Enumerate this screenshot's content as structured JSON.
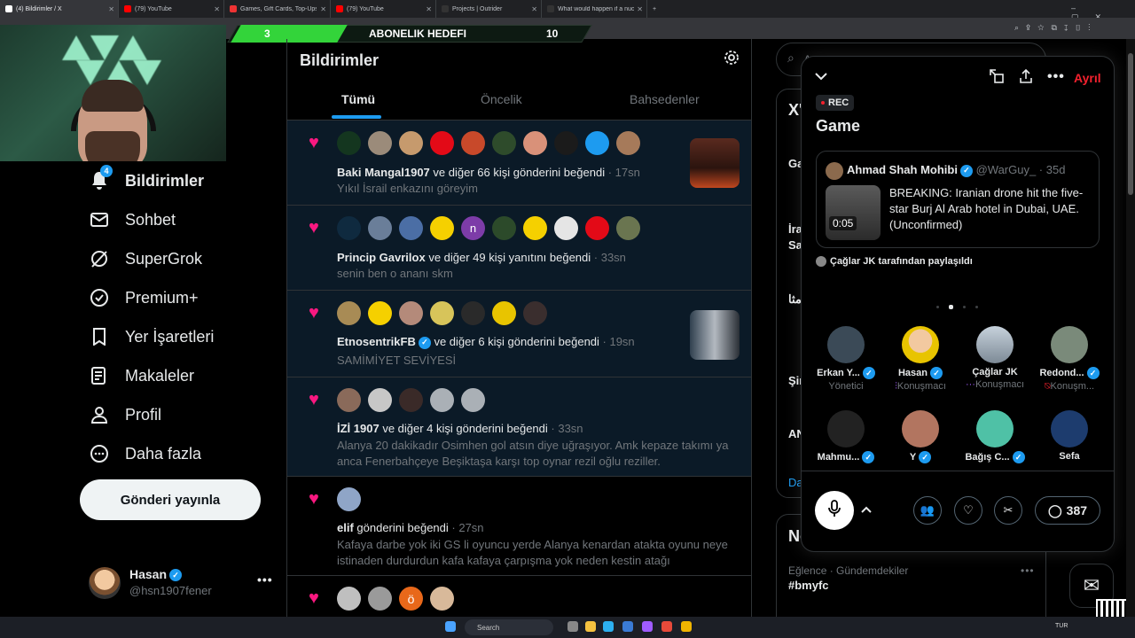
{
  "browser": {
    "tabs": [
      {
        "label": "(4) Bildirimler / X",
        "active": true
      },
      {
        "label": "(79) YouTube"
      },
      {
        "label": "Games, Gift Cards, Top-Ups & More"
      },
      {
        "label": "(79) YouTube"
      },
      {
        "label": "Projects | Outrider"
      },
      {
        "label": "What would happen if a nuclear"
      }
    ]
  },
  "subgoal": {
    "current": "3",
    "label": "ABONELIK HEDEFI",
    "target": "10",
    "progress_fraction": 0.3
  },
  "nav": {
    "badge": "4",
    "items": [
      {
        "label": "Bildirimler",
        "icon": "bell-icon"
      },
      {
        "label": "Sohbet",
        "icon": "mail-icon"
      },
      {
        "label": "SuperGrok",
        "icon": "grok-icon"
      },
      {
        "label": "Premium+",
        "icon": "premium-icon"
      },
      {
        "label": "Yer İşaretleri",
        "icon": "bookmark-icon"
      },
      {
        "label": "Makaleler",
        "icon": "article-icon"
      },
      {
        "label": "Profil",
        "icon": "person-icon"
      },
      {
        "label": "Daha fazla",
        "icon": "more-circle-icon"
      }
    ],
    "post_button": "Gönderi yayınla"
  },
  "profile": {
    "name": "Hasan",
    "handle": "@hsn1907fener",
    "more": "•••"
  },
  "center": {
    "title": "Bildirimler",
    "tabs": [
      "Tümü",
      "Öncelik",
      "Bahsedenler"
    ],
    "notifications": [
      {
        "name": "Baki Mangal1907",
        "action": " ve diğer 66 kişi gönderini beğendi",
        "time": " · 17sn",
        "text": "Yıkıl İsrail enkazını göreyim"
      },
      {
        "name": "Princip Gavrilox",
        "action": " ve diğer 49 kişi yanıtını beğendi",
        "time": " · 33sn",
        "text": "senin ben o ananı skm"
      },
      {
        "name": "EtnosentrikFB",
        "action": " ve diğer 6 kişi gönderini beğendi",
        "time": " · 19sn",
        "text": "SAMİMİYET SEVİYESİ"
      },
      {
        "name": "İZİ 1907",
        "action": " ve diğer 4 kişi gönderini beğendi",
        "time": " · 33sn",
        "text": "Alanya 20 dakikadır Osimhen gol atsın diye uğraşıyor. Amk kepaze takımı ya anca Fenerbahçeye Beşiktaşa karşı top oynar rezil oğlu reziller."
      },
      {
        "name": "elif",
        "action": " gönderini beğendi",
        "time": " · 27sn",
        "text": "Kafaya darbe yok iki GS li oyuncu yerde Alanya kenardan atakta oyunu neye istinaden durdurdun kafa kafaya çarpışma yok neden kestin atağı"
      }
    ],
    "sixth_avatar_letter": "ö",
    "second_avatar_letter": "n"
  },
  "right": {
    "search_placeholder": "A",
    "partials": [
      "X'",
      "Ga",
      "İra",
      "Sa",
      "مثا",
      "Şir",
      "AN",
      "Da",
      "No"
    ],
    "trend_meta": "Eğlence · Gündemdekiler",
    "trend_tag": "#bmyfc",
    "trend_more": "•••"
  },
  "space": {
    "leave": "Ayrıl",
    "rec": "REC",
    "title": "Game",
    "pinned": {
      "name": "Ahmad Shah Mohibi",
      "handle": "@WarGuy_ · 35d",
      "duration": "0:05",
      "text": "BREAKING: Iranian drone hit the five-star Burj Al Arab hotel in Dubai, UAE. (Unconfirmed)"
    },
    "shared_by": "Çağlar JK tarafından paylaşıldı",
    "speakers": [
      {
        "name": "Erkan Y...",
        "role": "Yönetici",
        "verified": true
      },
      {
        "name": "Hasan",
        "role": "Konuşmacı",
        "verified": true
      },
      {
        "name": "Çağlar JK",
        "role": "Konuşmacı",
        "verified": false
      },
      {
        "name": "Redond...",
        "role": "Konuşm...",
        "verified": true
      },
      {
        "name": "Mahmu...",
        "role": "",
        "verified": true
      },
      {
        "name": "Y",
        "role": "",
        "verified": true
      },
      {
        "name": "Bağış C...",
        "role": "",
        "verified": true
      },
      {
        "name": "Sefa",
        "role": "",
        "verified": false
      }
    ],
    "comments": "387"
  },
  "taskbar": {
    "search": "Search",
    "lang": "TUR"
  },
  "colors": {
    "accent": "#1d9bf0",
    "like": "#f91880",
    "leave": "#f4212e",
    "subgoal": "#33d43a"
  }
}
